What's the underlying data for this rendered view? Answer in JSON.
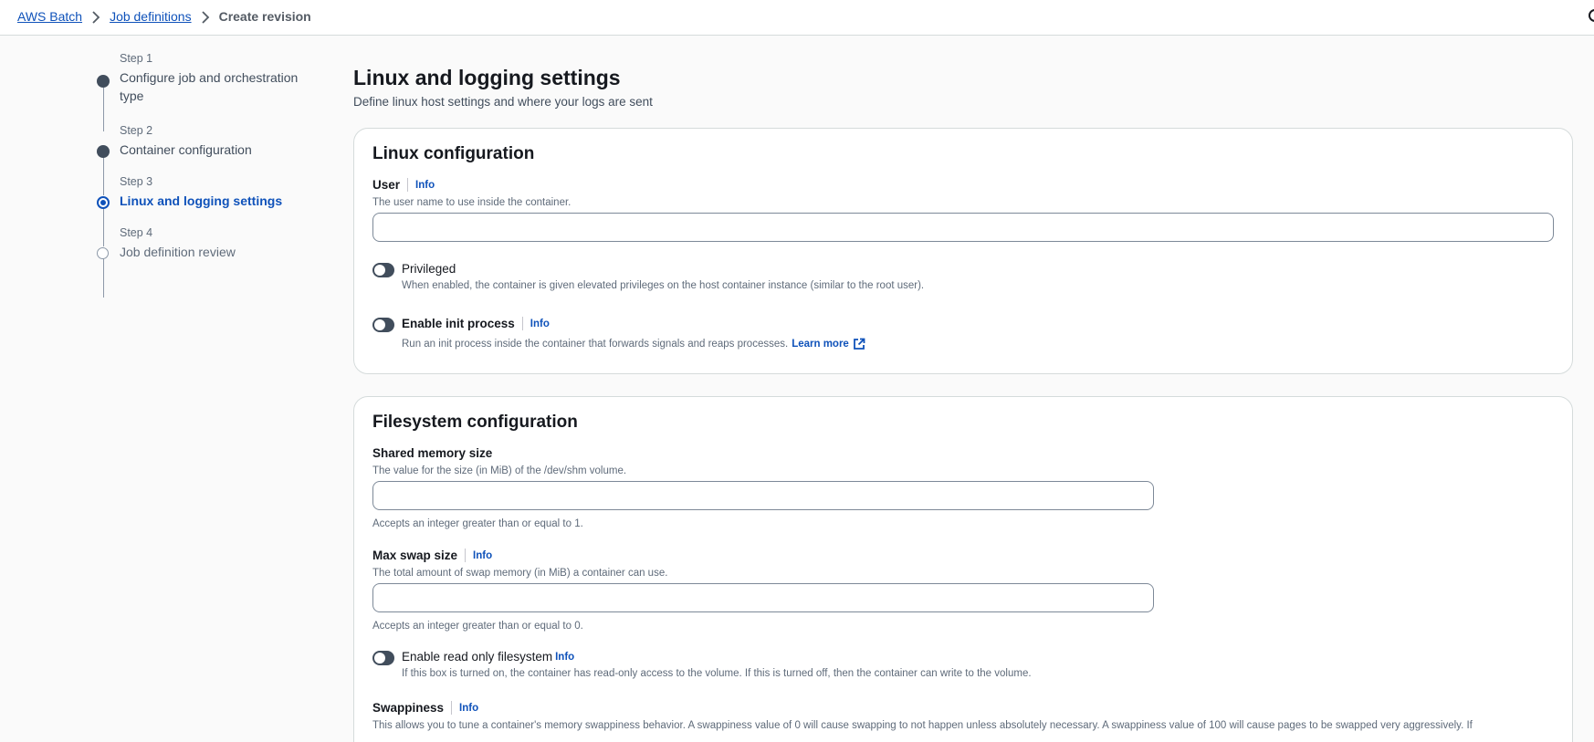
{
  "breadcrumb": {
    "items": [
      "AWS Batch",
      "Job definitions"
    ],
    "current": "Create revision"
  },
  "steps": [
    {
      "num": "Step 1",
      "title": "Configure job and orchestration type",
      "state": "complete"
    },
    {
      "num": "Step 2",
      "title": "Container configuration",
      "state": "complete"
    },
    {
      "num": "Step 3",
      "title": "Linux and logging settings",
      "state": "active"
    },
    {
      "num": "Step 4",
      "title": "Job definition review",
      "state": "disabled"
    }
  ],
  "page": {
    "title": "Linux and logging settings",
    "description": "Define linux host settings and where your logs are sent"
  },
  "linux": {
    "title": "Linux configuration",
    "user_label": "User",
    "info": "Info",
    "user_desc": "The user name to use inside the container.",
    "user_value": "",
    "privileged_label": "Privileged",
    "privileged_desc": "When enabled, the container is given elevated privileges on the host container instance (similar to the root user).",
    "privileged_on": false,
    "init_label": "Enable init process",
    "init_desc": "Run an init process inside the container that forwards signals and reaps processes.",
    "learn_more": "Learn more",
    "init_on": false
  },
  "filesystem": {
    "title": "Filesystem configuration",
    "shm_label": "Shared memory size",
    "shm_desc": "The value for the size (in MiB) of the /dev/shm volume.",
    "shm_value": "",
    "shm_constraint": "Accepts an integer greater than or equal to 1.",
    "swap_label": "Max swap size",
    "swap_desc": "The total amount of swap memory (in MiB) a container can use.",
    "swap_value": "",
    "swap_constraint": "Accepts an integer greater than or equal to 0.",
    "readonly_label": "Enable read only filesystem",
    "readonly_desc": "If this box is turned on, the container has read-only access to the volume. If this is turned off, then the container can write to the volume.",
    "readonly_on": false,
    "swappiness_label": "Swappiness",
    "swappiness_desc": "This allows you to tune a container's memory swappiness behavior. A swappiness value of 0 will cause swapping to not happen unless absolutely necessary. A swappiness value of 100 will cause pages to be swapped very aggressively. If"
  }
}
